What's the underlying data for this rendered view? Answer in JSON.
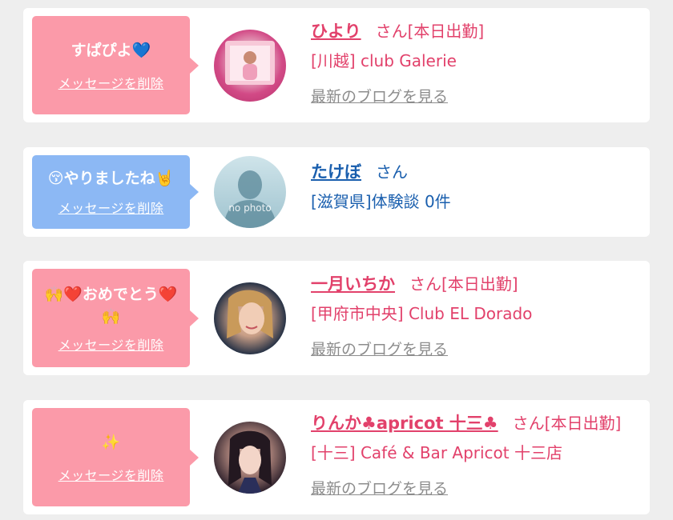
{
  "colors": {
    "card_bg": "#ffffff",
    "page_bg": "#eeeeee",
    "bubble_pink": "#fb9aa9",
    "bubble_blue": "#8cb8f4",
    "name_pink": "#e2416b",
    "name_blue": "#1a5fae",
    "blog_gray": "#8c8c8c"
  },
  "messages": [
    {
      "bubble_text": "すぱぴよ💙",
      "delete_label": "メッセージを削除",
      "name": "ひより",
      "honorific": "さん",
      "status": "[本日出勤]",
      "shop": "[川越] club Galerie",
      "blog_label": "最新のブログを見る"
    },
    {
      "bubble_text": "😚やりましたね🤘",
      "delete_label": "メッセージを削除",
      "name": "たけぼ",
      "honorific": "さん",
      "shop": "[滋賀県]体験談 0件",
      "avatar_text": "no photo"
    },
    {
      "bubble_text": "🙌❤️おめでとう❤️🙌",
      "delete_label": "メッセージを削除",
      "name": "一月いちか",
      "honorific": "さん",
      "status": "[本日出勤]",
      "shop": "[甲府市中央] Club EL Dorado",
      "blog_label": "最新のブログを見る"
    },
    {
      "bubble_text": "✨",
      "delete_label": "メッセージを削除",
      "name": "りんか♣apricot 十三♣",
      "honorific": "さん",
      "status": "[本日出勤]",
      "shop": "[十三] Café & Bar Apricot 十三店",
      "blog_label": "最新のブログを見る"
    }
  ]
}
